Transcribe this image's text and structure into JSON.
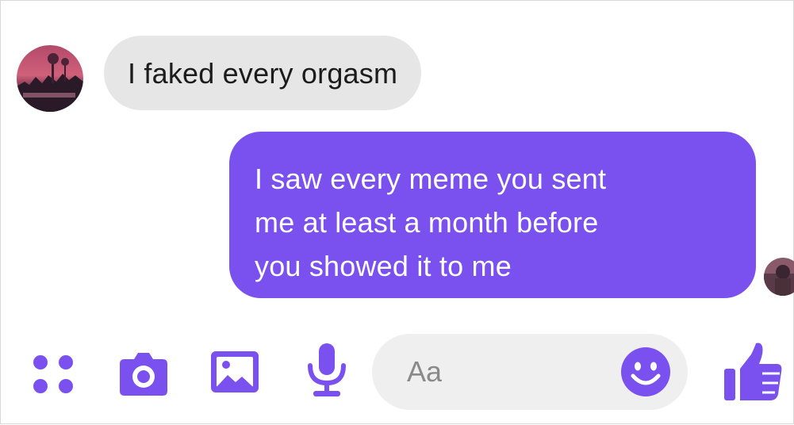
{
  "conversation": {
    "messages": [
      {
        "direction": "received",
        "lines": [
          "I faked every orgasm"
        ]
      },
      {
        "direction": "sent",
        "lines": [
          "I saw every meme you sent",
          "me at least a month before",
          "you showed it to me"
        ]
      }
    ]
  },
  "composer": {
    "placeholder": "Aa",
    "icons": {
      "more": "grid-dots-icon",
      "camera": "camera-icon",
      "image": "image-icon",
      "mic": "microphone-icon",
      "emoji": "smiley-emoji-icon",
      "like": "thumbs-up-icon"
    }
  },
  "colors": {
    "accent": "#7a50ee",
    "received_bubble": "#e6e6e6",
    "input_background": "#efefef"
  }
}
